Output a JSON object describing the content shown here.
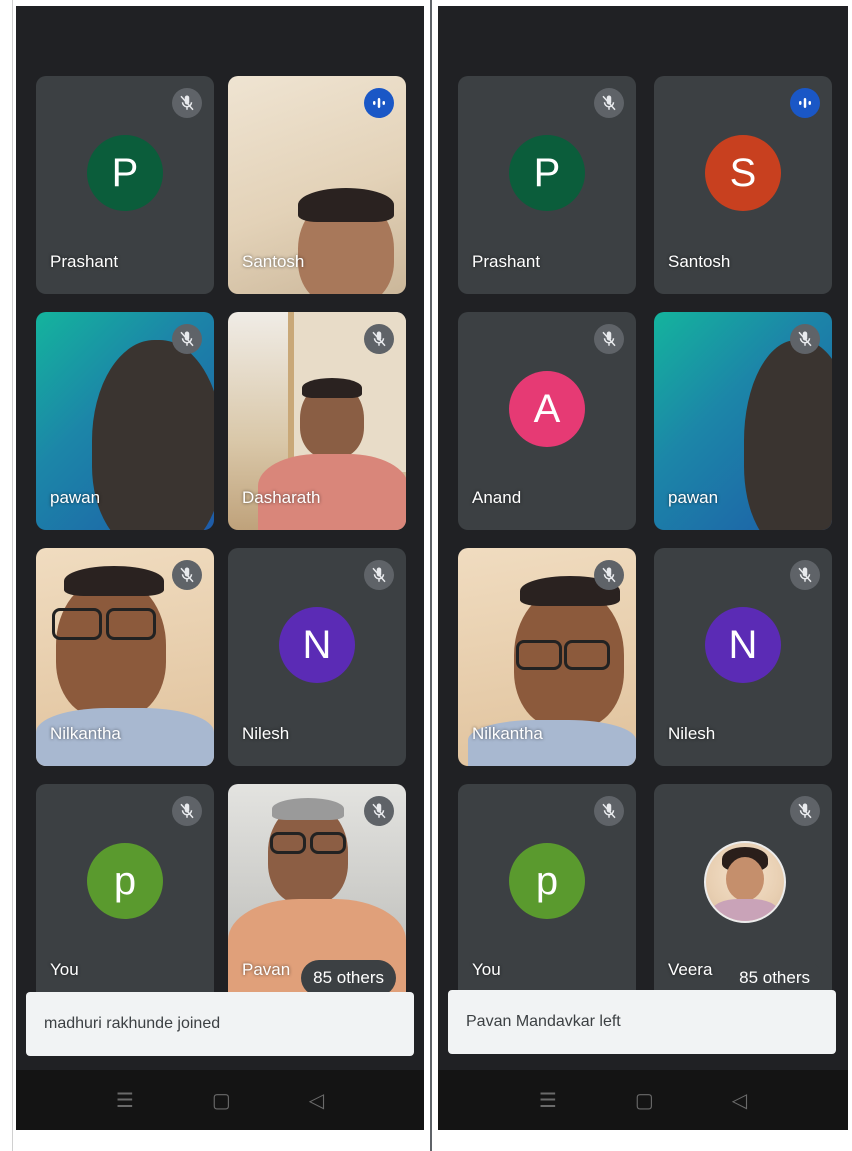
{
  "left": {
    "tiles": [
      {
        "name": "Prashant",
        "initial": "P",
        "avatar_color": "#0b5d3b",
        "mic": "muted"
      },
      {
        "name": "Santosh",
        "mic": "speaking"
      },
      {
        "name": "pawan",
        "mic": "muted"
      },
      {
        "name": "Dasharath",
        "mic": "muted"
      },
      {
        "name": "Nilkantha",
        "mic": "muted"
      },
      {
        "name": "Nilesh",
        "initial": "N",
        "avatar_color": "#5b2bb5",
        "mic": "muted"
      },
      {
        "name": "You",
        "initial": "p",
        "avatar_color": "#5a9a2e",
        "mic": "muted"
      },
      {
        "name": "Pavan",
        "mic": "muted"
      }
    ],
    "others_label": "85 others",
    "toast": "madhuri rakhunde joined"
  },
  "right": {
    "tiles": [
      {
        "name": "Prashant",
        "initial": "P",
        "avatar_color": "#0b5d3b",
        "mic": "muted"
      },
      {
        "name": "Santosh",
        "initial": "S",
        "avatar_color": "#c8401f",
        "mic": "speaking"
      },
      {
        "name": "Anand",
        "initial": "A",
        "avatar_color": "#e63a74",
        "mic": "muted"
      },
      {
        "name": "pawan",
        "mic": "muted"
      },
      {
        "name": "Nilkantha",
        "mic": "muted"
      },
      {
        "name": "Nilesh",
        "initial": "N",
        "avatar_color": "#5b2bb5",
        "mic": "muted"
      },
      {
        "name": "You",
        "initial": "p",
        "avatar_color": "#5a9a2e",
        "mic": "muted"
      },
      {
        "name": "Veera",
        "mic": "muted"
      }
    ],
    "others_label": "85 others",
    "toast": "Pavan Mandavkar left"
  },
  "navbar": {
    "menu_icon": "☰",
    "home_icon": "▢",
    "back_icon": "◁"
  }
}
